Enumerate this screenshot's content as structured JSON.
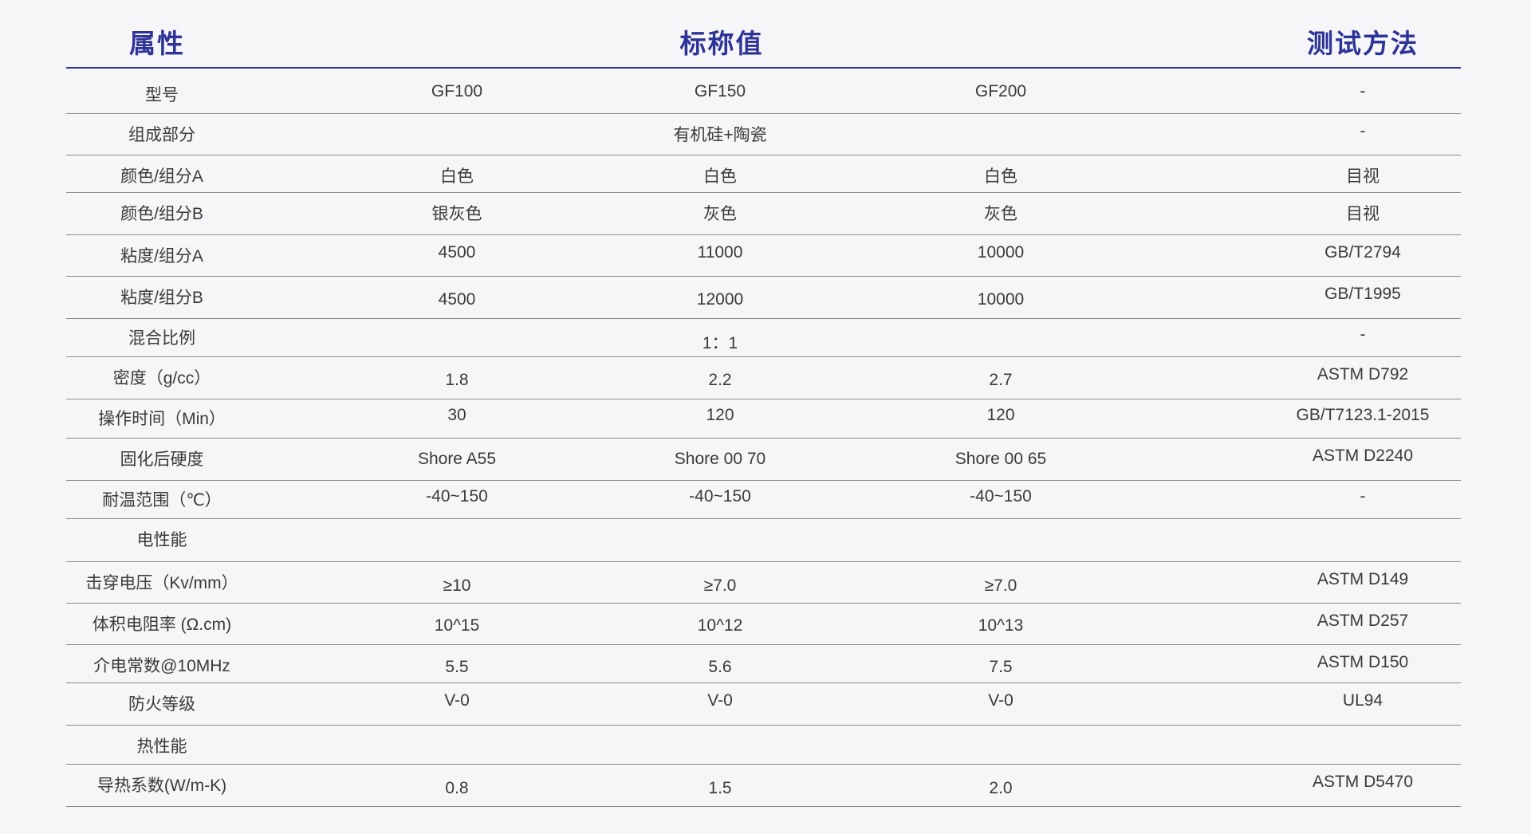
{
  "header": {
    "property": "属性",
    "nominal_value": "标称值",
    "test_method": "测试方法"
  },
  "rows": [
    {
      "property": "型号",
      "gf100": "GF100",
      "gf150": "GF150",
      "gf200": "GF200",
      "method": "-"
    },
    {
      "property": "组成部分",
      "gf100": "",
      "gf150": "有机硅+陶瓷",
      "gf200": "",
      "method": "-"
    },
    {
      "property": "颜色/组分A",
      "gf100": "白色",
      "gf150": "白色",
      "gf200": "白色",
      "method": "目视"
    },
    {
      "property": "颜色/组分B",
      "gf100": "银灰色",
      "gf150": "灰色",
      "gf200": "灰色",
      "method": "目视"
    },
    {
      "property": "粘度/组分A",
      "gf100": "4500",
      "gf150": "11000",
      "gf200": "10000",
      "method": "GB/T2794"
    },
    {
      "property": "粘度/组分B",
      "gf100": "4500",
      "gf150": "12000",
      "gf200": "10000",
      "method": "GB/T1995"
    },
    {
      "property": "混合比例",
      "gf100": "",
      "gf150": "1：1",
      "gf200": "",
      "method": "-"
    },
    {
      "property": "密度（g/cc）",
      "gf100": "1.8",
      "gf150": "2.2",
      "gf200": "2.7",
      "method": "ASTM D792"
    },
    {
      "property": "操作时间（Min）",
      "gf100": "30",
      "gf150": "120",
      "gf200": "120",
      "method": "GB/T7123.1-2015"
    },
    {
      "property": "固化后硬度",
      "gf100": "Shore A55",
      "gf150": "Shore 00 70",
      "gf200": "Shore 00 65",
      "method": "ASTM D2240"
    },
    {
      "property": "耐温范围（℃）",
      "gf100": "-40~150",
      "gf150": "-40~150",
      "gf200": "-40~150",
      "method": "-"
    },
    {
      "property": "电性能",
      "gf100": "",
      "gf150": "",
      "gf200": "",
      "method": ""
    },
    {
      "property": "击穿电压（Kv/mm）",
      "gf100": "≥10",
      "gf150": "≥7.0",
      "gf200": "≥7.0",
      "method": "ASTM D149"
    },
    {
      "property": "体积电阻率 (Ω.cm)",
      "gf100": "10^15",
      "gf150": "10^12",
      "gf200": "10^13",
      "method": "ASTM D257"
    },
    {
      "property": "介电常数@10MHz",
      "gf100": "5.5",
      "gf150": "5.6",
      "gf200": "7.5",
      "method": "ASTM D150"
    },
    {
      "property": "防火等级",
      "gf100": "V-0",
      "gf150": "V-0",
      "gf200": "V-0",
      "method": "UL94"
    },
    {
      "property": "热性能",
      "gf100": "",
      "gf150": "",
      "gf200": "",
      "method": ""
    },
    {
      "property": "导热系数(W/m-K)",
      "gf100": "0.8",
      "gf150": "1.5",
      "gf200": "2.0",
      "method": "ASTM D5470"
    }
  ]
}
